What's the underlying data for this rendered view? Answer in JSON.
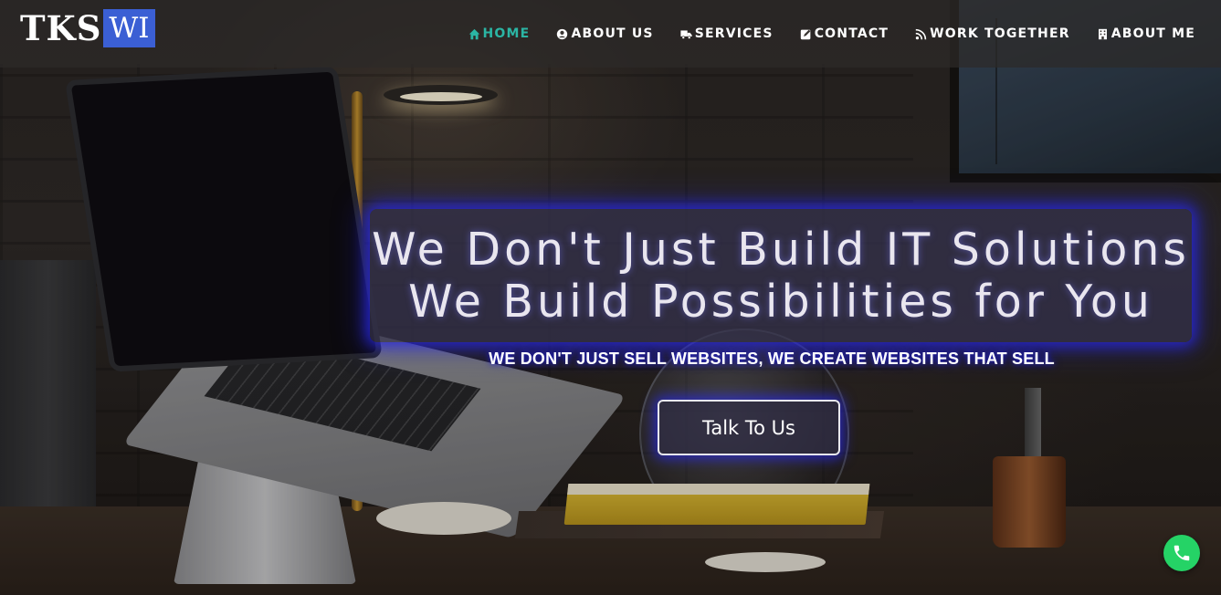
{
  "logo": {
    "part1": "TKS",
    "part2": "WI"
  },
  "nav": {
    "items": [
      {
        "label": "HOME",
        "icon": "home-icon",
        "active": true
      },
      {
        "label": "ABOUT US",
        "icon": "user-circle-icon",
        "active": false
      },
      {
        "label": "SERVICES",
        "icon": "truck-icon",
        "active": false
      },
      {
        "label": "CONTACT",
        "icon": "edit-icon",
        "active": false
      },
      {
        "label": "WORK TOGETHER",
        "icon": "rss-icon",
        "active": false
      },
      {
        "label": "ABOUT ME",
        "icon": "building-icon",
        "active": false
      }
    ]
  },
  "hero": {
    "headline_line1": "We Don't Just Build IT Solutions",
    "headline_line2": "We Build Possibilities for You",
    "subheadline": "WE DON'T JUST SELL WEBSITES, WE CREATE WEBSITES THAT SELL",
    "cta_label": "Talk To Us"
  },
  "floating": {
    "phone_icon": "phone-icon"
  },
  "colors": {
    "nav_active": "#2bb5a4",
    "logo_accent": "#3b5fd4",
    "glow": "#2828e6",
    "phone_button": "#25d366"
  }
}
